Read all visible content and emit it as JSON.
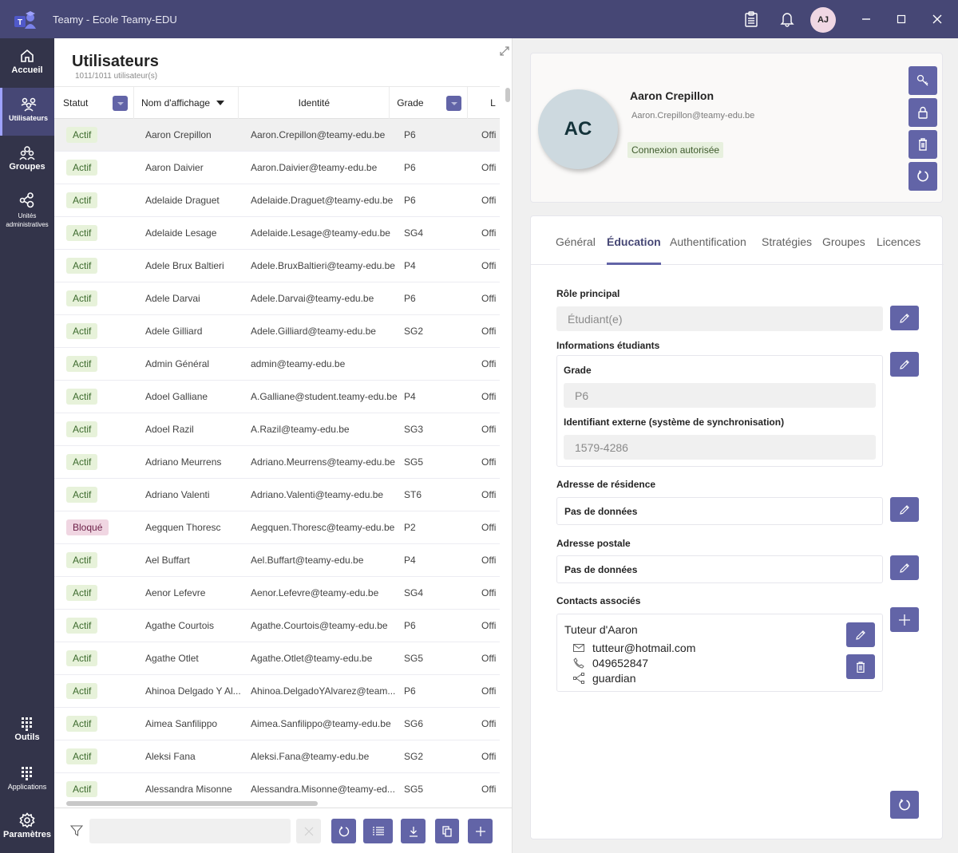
{
  "window": {
    "title": "Teamy - Ecole Teamy-EDU",
    "user_initials": "AJ",
    "icons": [
      "clipboard-icon",
      "bell-icon",
      "minimize-icon",
      "maximize-icon",
      "close-icon"
    ]
  },
  "rail": {
    "items": [
      {
        "label": "Accueil",
        "icon": "home-icon"
      },
      {
        "label": "Utilisateurs",
        "icon": "users-icon",
        "active": true
      },
      {
        "label": "Groupes",
        "icon": "groups-icon"
      },
      {
        "label": "Unités administratives",
        "icon": "admin-units-icon"
      },
      {
        "label": "Outils",
        "icon": "grid-icon"
      },
      {
        "label": "Applications",
        "icon": "apps-icon"
      },
      {
        "label": "Paramètres",
        "icon": "gear-icon"
      }
    ]
  },
  "users_panel": {
    "title": "Utilisateurs",
    "count": "1011/1011 utilisateur(s)",
    "columns": [
      "Statut",
      "Nom d'affichage",
      "Identité",
      "Grade",
      "L"
    ],
    "rows": [
      {
        "status": "Actif",
        "name": "Aaron Crepillon",
        "identity": "Aaron.Crepillon@teamy-edu.be",
        "grade": "P6",
        "extra": "Offi"
      },
      {
        "status": "Actif",
        "name": "Aaron Daivier",
        "identity": "Aaron.Daivier@teamy-edu.be",
        "grade": "P6",
        "extra": "Offi"
      },
      {
        "status": "Actif",
        "name": "Adelaide Draguet",
        "identity": "Adelaide.Draguet@teamy-edu.be",
        "grade": "P6",
        "extra": "Offi"
      },
      {
        "status": "Actif",
        "name": "Adelaide Lesage",
        "identity": "Adelaide.Lesage@teamy-edu.be",
        "grade": "SG4",
        "extra": "Offi"
      },
      {
        "status": "Actif",
        "name": "Adele Brux Baltieri",
        "identity": "Adele.BruxBaltieri@teamy-edu.be",
        "grade": "P4",
        "extra": "Offi"
      },
      {
        "status": "Actif",
        "name": "Adele Darvai",
        "identity": "Adele.Darvai@teamy-edu.be",
        "grade": "P6",
        "extra": "Offi"
      },
      {
        "status": "Actif",
        "name": "Adele Gilliard",
        "identity": "Adele.Gilliard@teamy-edu.be",
        "grade": "SG2",
        "extra": "Offi"
      },
      {
        "status": "Actif",
        "name": "Admin Général",
        "identity": "admin@teamy-edu.be",
        "grade": "",
        "extra": "Offi"
      },
      {
        "status": "Actif",
        "name": "Adoel Galliane",
        "identity": "A.Galliane@student.teamy-edu.be",
        "grade": "P4",
        "extra": "Offi"
      },
      {
        "status": "Actif",
        "name": "Adoel Razil",
        "identity": "A.Razil@teamy-edu.be",
        "grade": "SG3",
        "extra": "Offi"
      },
      {
        "status": "Actif",
        "name": "Adriano Meurrens",
        "identity": "Adriano.Meurrens@teamy-edu.be",
        "grade": "SG5",
        "extra": "Offi"
      },
      {
        "status": "Actif",
        "name": "Adriano Valenti",
        "identity": "Adriano.Valenti@teamy-edu.be",
        "grade": "ST6",
        "extra": "Offi"
      },
      {
        "status": "Bloqué",
        "name": "Aegquen Thoresc",
        "identity": "Aegquen.Thoresc@teamy-edu.be",
        "grade": "P2",
        "extra": "Offi"
      },
      {
        "status": "Actif",
        "name": "Ael Buffart",
        "identity": "Ael.Buffart@teamy-edu.be",
        "grade": "P4",
        "extra": "Offi"
      },
      {
        "status": "Actif",
        "name": "Aenor Lefevre",
        "identity": "Aenor.Lefevre@teamy-edu.be",
        "grade": "SG4",
        "extra": "Offi"
      },
      {
        "status": "Actif",
        "name": "Agathe Courtois",
        "identity": "Agathe.Courtois@teamy-edu.be",
        "grade": "P6",
        "extra": "Offi"
      },
      {
        "status": "Actif",
        "name": "Agathe Otlet",
        "identity": "Agathe.Otlet@teamy-edu.be",
        "grade": "SG5",
        "extra": "Offi"
      },
      {
        "status": "Actif",
        "name": "Ahinoa Delgado Y Al...",
        "identity": "Ahinoa.DelgadoYAlvarez@team...",
        "grade": "P6",
        "extra": "Offi"
      },
      {
        "status": "Actif",
        "name": "Aimea Sanfilippo",
        "identity": "Aimea.Sanfilippo@teamy-edu.be",
        "grade": "SG6",
        "extra": "Offi"
      },
      {
        "status": "Actif",
        "name": "Aleksi Fana",
        "identity": "Aleksi.Fana@teamy-edu.be",
        "grade": "SG2",
        "extra": "Offi"
      },
      {
        "status": "Actif",
        "name": "Alessandra Misonne",
        "identity": "Alessandra.Misonne@teamy-ed...",
        "grade": "SG5",
        "extra": "Offi"
      }
    ],
    "footer": {
      "filter_placeholder": "",
      "buttons": [
        "clear-icon",
        "refresh-icon",
        "columns-icon",
        "download-icon",
        "copy-icon",
        "add-icon"
      ]
    }
  },
  "detail": {
    "initials": "AC",
    "name": "Aaron Crepillon",
    "email": "Aaron.Crepillon@teamy-edu.be",
    "login_status": "Connexion autorisée",
    "actions": [
      "key-icon",
      "lock-icon",
      "delete-icon",
      "refresh-icon"
    ],
    "tabs": [
      "Général",
      "Éducation",
      "Authentification",
      "Stratégies",
      "Groupes",
      "Licences"
    ],
    "active_tab": "Éducation",
    "education": {
      "role_label": "Rôle principal",
      "role_value": "Étudiant(e)",
      "student_info_label": "Informations étudiants",
      "grade_label": "Grade",
      "grade_value": "P6",
      "external_id_label": "Identifiant externe (système de synchronisation)",
      "external_id_value": "1579-4286",
      "residence_label": "Adresse de résidence",
      "residence_value": "Pas de données",
      "postal_label": "Adresse postale",
      "postal_value": "Pas de données",
      "contacts_label": "Contacts associés",
      "contact": {
        "name": "Tuteur d'Aaron",
        "email": "tutteur@hotmail.com",
        "phone": "049652847",
        "relation": "guardian"
      }
    }
  },
  "colors": {
    "brand": "#464775",
    "accent": "#6264a7",
    "rail": "#33344a",
    "active_badge_bg": "#e7f2da",
    "blocked_badge_bg": "#f0d6e2"
  }
}
